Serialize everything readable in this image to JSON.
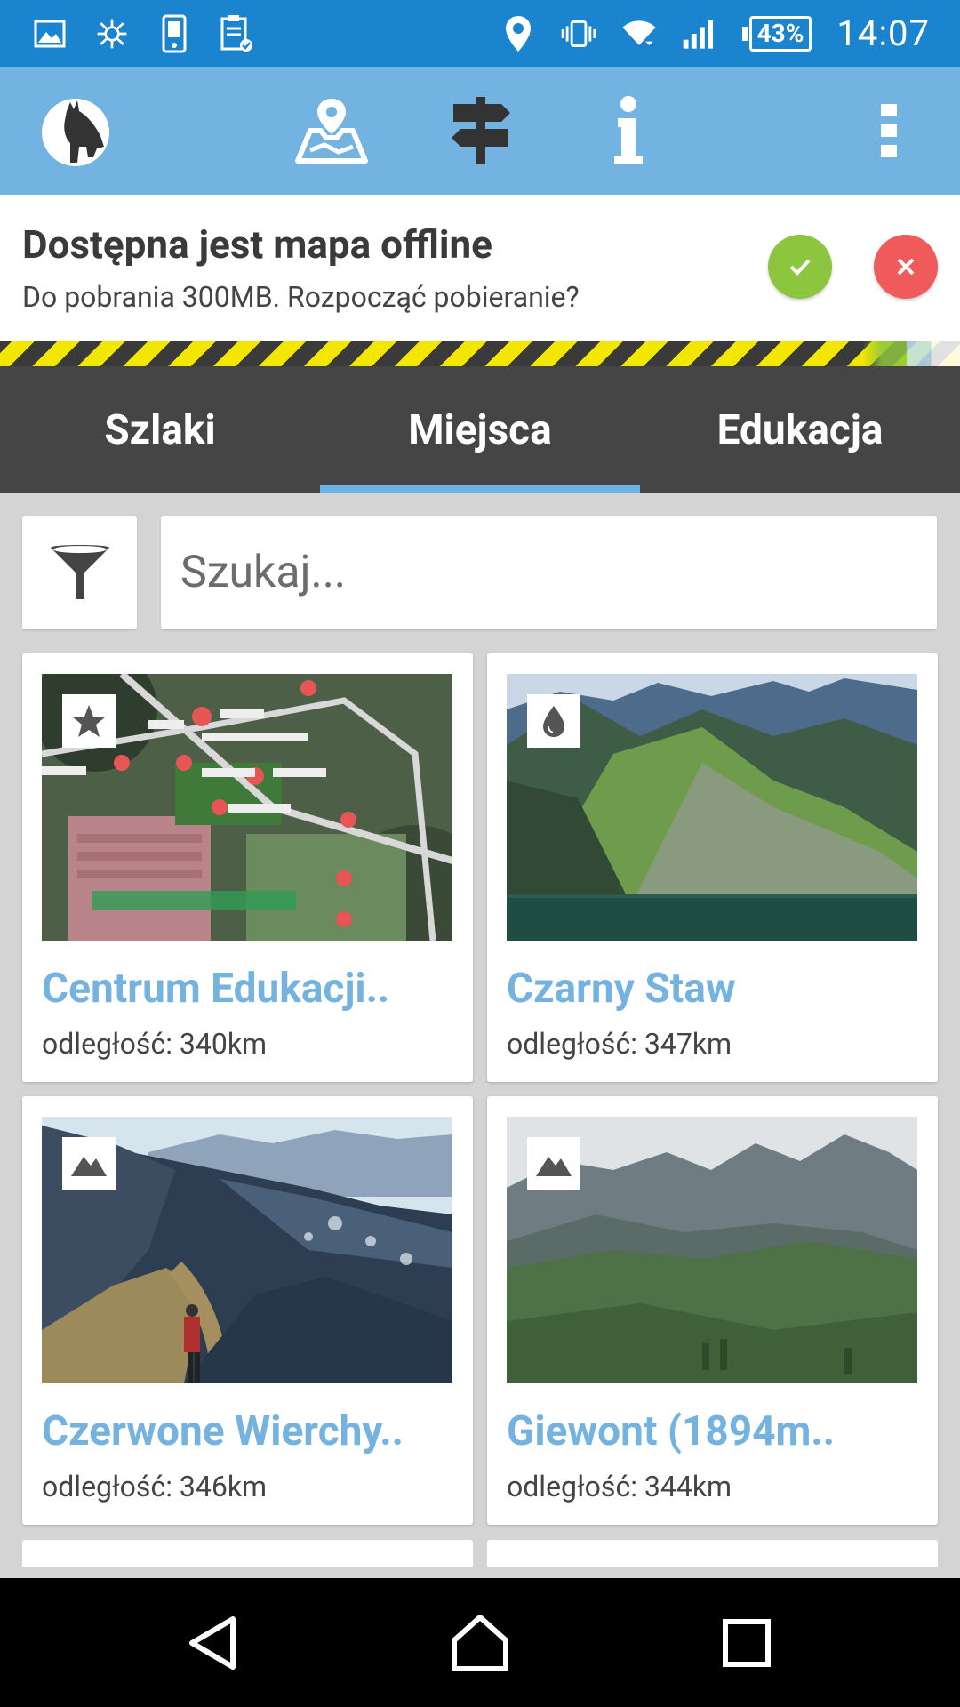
{
  "status_bar": {
    "battery": "43%",
    "time": "14:07"
  },
  "toolbar": {
    "icons": [
      "logo-icon",
      "map-icon",
      "signpost-icon",
      "info-icon",
      "more-icon"
    ]
  },
  "banner": {
    "title": "Dostępna jest mapa offline",
    "subtitle": "Do pobrania 300MB. Rozpocząć pobieranie?",
    "accept_color": "#8cc63f",
    "decline_color": "#f05a5a"
  },
  "tabs": [
    {
      "label": "Szlaki",
      "active": false
    },
    {
      "label": "Miejsca",
      "active": true
    },
    {
      "label": "Edukacja",
      "active": false
    }
  ],
  "search": {
    "placeholder": "Szukaj..."
  },
  "places": [
    {
      "title": "Centrum Edukacji..",
      "distance": "odległość: 340km",
      "badge": "star-icon"
    },
    {
      "title": "Czarny Staw",
      "distance": "odległość: 347km",
      "badge": "water-drop-icon"
    },
    {
      "title": "Czerwone Wierchy..",
      "distance": "odległość: 346km",
      "badge": "mountain-icon"
    },
    {
      "title": "Giewont (1894m..",
      "distance": "odległość: 344km",
      "badge": "mountain-icon"
    }
  ],
  "colors": {
    "status_bar": "#1a84cf",
    "toolbar": "#72b3e1",
    "tabs": "#454545",
    "accent": "#74b2e0"
  }
}
